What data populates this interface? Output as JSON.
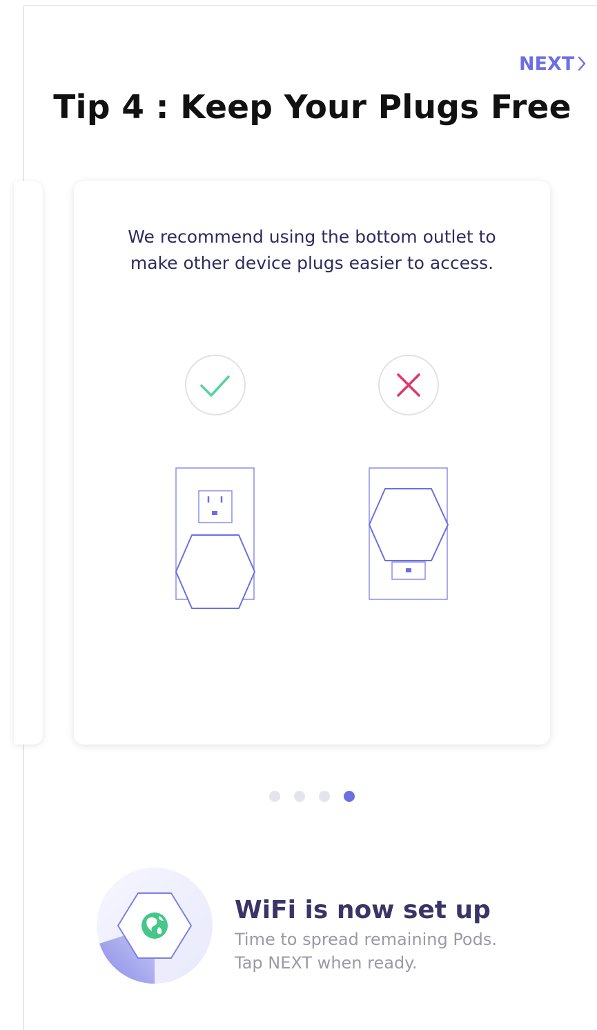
{
  "header": {
    "next_label": "NEXT",
    "title": "Tip 4 : Keep Your Plugs Free"
  },
  "tip_card": {
    "description": "We recommend using the bottom outlet to make other device plugs easier to access.",
    "options": [
      {
        "name": "correct",
        "icon": "check-icon",
        "color": "#57d39a"
      },
      {
        "name": "incorrect",
        "icon": "x-icon",
        "color": "#e2356b"
      }
    ]
  },
  "pager": {
    "total": 4,
    "active_index": 3
  },
  "status": {
    "title": "WiFi is now set up",
    "line1": "Time to spread remaining Pods.",
    "line2": "Tap NEXT when ready.",
    "icon": "globe-icon",
    "progress_fraction": 0.2
  },
  "colors": {
    "accent": "#6b6fe2",
    "outline": "#6b6fe2",
    "text_dark": "#2f2a5e",
    "success": "#57d39a",
    "error": "#e2356b"
  }
}
